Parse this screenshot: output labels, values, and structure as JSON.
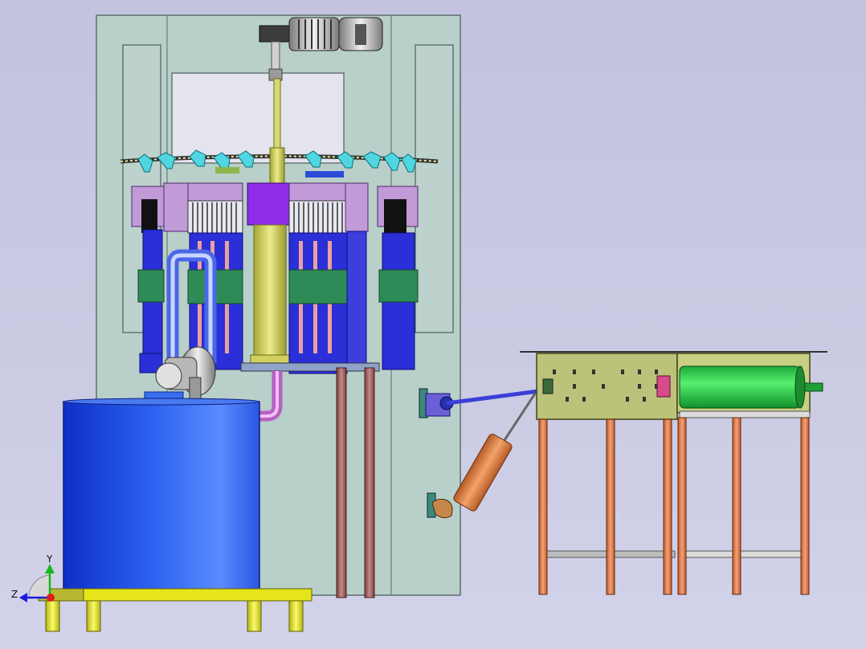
{
  "viewport": {
    "background_top": "#c3c3e0",
    "background_bottom": "#d2d3ea"
  },
  "triad": {
    "y_label": "Y",
    "z_label": "Z",
    "y_color": "#17b817",
    "z_color": "#1a1adf",
    "x_color": "#e01a1a"
  },
  "colors": {
    "frame": "#b9cfc9",
    "tank": "#1e4fe8",
    "base": "#e5e51a",
    "magenta_pipe": "#dc8fe0",
    "brown_pipe": "#9a5a5a",
    "bracket": "#6a5fd6",
    "bracket_green": "#2e8b57",
    "cylinder_copper": "#e08a4a",
    "cabinet": "#bcc27a",
    "legs": "#e27845",
    "motor_green": "#28d64a",
    "column": "#d9d86a",
    "purple_block": "#8e2ee8"
  }
}
